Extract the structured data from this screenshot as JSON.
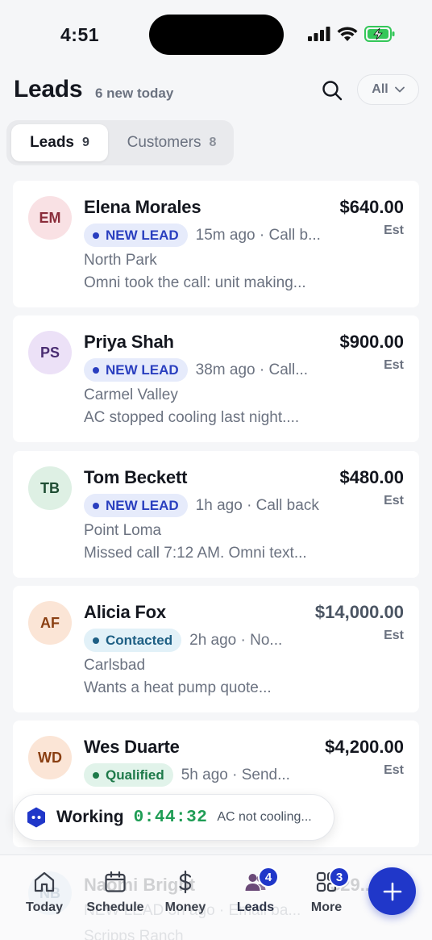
{
  "status_bar": {
    "time": "4:51",
    "icons": [
      "signal-icon",
      "wifi-icon",
      "battery-charging-icon"
    ]
  },
  "header": {
    "title": "Leads",
    "subtitle": "6 new today",
    "filter_label": "All"
  },
  "segments": [
    {
      "label": "Leads",
      "count": "9",
      "active": true
    },
    {
      "label": "Customers",
      "count": "8",
      "active": false
    }
  ],
  "leads": [
    {
      "initials": "EM",
      "name": "Elena Morales",
      "amount": "$640.00",
      "amount_note": "Est",
      "status": "NEW LEAD",
      "meta": "15m ago · Call b...",
      "location": "North Park",
      "note": "Omni took the call: unit making...",
      "avatar_bg": "#f9e1e4",
      "avatar_fg": "#8a2c3a"
    },
    {
      "initials": "PS",
      "name": "Priya Shah",
      "amount": "$900.00",
      "amount_note": "Est",
      "status": "NEW LEAD",
      "meta": "38m ago · Call...",
      "location": "Carmel Valley",
      "note": "AC stopped cooling last night....",
      "avatar_bg": "#ece1f7",
      "avatar_fg": "#4a2d72"
    },
    {
      "initials": "TB",
      "name": "Tom Beckett",
      "amount": "$480.00",
      "amount_note": "Est",
      "status": "NEW LEAD",
      "meta": "1h ago · Call back",
      "location": "Point Loma",
      "note": "Missed call 7:12 AM. Omni text...",
      "avatar_bg": "#def0e4",
      "avatar_fg": "#1f4d33"
    },
    {
      "initials": "AF",
      "name": "Alicia Fox",
      "amount": "$14,000.00",
      "amount_note": "Est",
      "status": "Contacted",
      "meta": "2h ago · No...",
      "location": "Carlsbad",
      "note": "Wants a heat pump quote...",
      "avatar_bg": "#fbe5d6",
      "avatar_fg": "#8a3f12"
    },
    {
      "initials": "WD",
      "name": "Wes Duarte",
      "amount": "$4,200.00",
      "amount_note": "Est",
      "status": "Qualified",
      "meta": "5h ago · Send...",
      "location": "",
      "note": "",
      "avatar_bg": "#fbe5d6",
      "avatar_fg": "#8a3f12"
    }
  ],
  "status_styles": {
    "NEW LEAD": {
      "bg": "#e6ebfb",
      "fg": "#2a3fbf",
      "dot": "#2a3fbf"
    },
    "Contacted": {
      "bg": "#e2f1f8",
      "fg": "#1e5f84",
      "dot": "#1e5f84"
    },
    "Qualified": {
      "bg": "#e1f3ea",
      "fg": "#1e7a4a",
      "dot": "#1e7a4a"
    }
  },
  "working": {
    "label": "Working",
    "timer": "0:44:32",
    "task": "AC not cooling..."
  },
  "ghost_card": {
    "initials": "NB",
    "name": "Naomi Bright",
    "amount": "$29...",
    "meta": "NEW LEAD 3h ago · Email ba...",
    "location": "Scripps Ranch"
  },
  "tabs": [
    {
      "label": "Today",
      "icon": "home-icon",
      "badge": ""
    },
    {
      "label": "Schedule",
      "icon": "calendar-icon",
      "badge": ""
    },
    {
      "label": "Money",
      "icon": "dollar-icon",
      "badge": ""
    },
    {
      "label": "Leads",
      "icon": "people-icon",
      "badge": "4"
    },
    {
      "label": "More",
      "icon": "grid-icon",
      "badge": "3"
    }
  ],
  "fab": {
    "icon": "plus-icon"
  },
  "colors": {
    "accent": "#2037c9",
    "timer_green": "#1f9d55"
  }
}
